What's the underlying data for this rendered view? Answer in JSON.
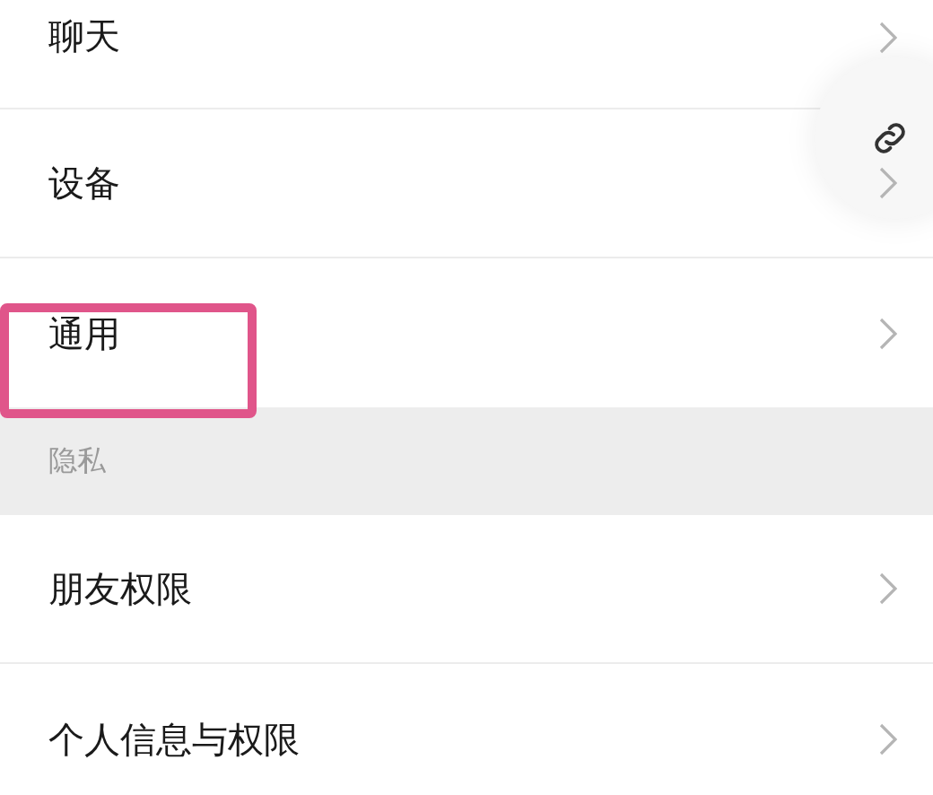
{
  "items": [
    {
      "kind": "row",
      "label": "聊天",
      "highlighted": false
    },
    {
      "kind": "row",
      "label": "设备",
      "highlighted": false
    },
    {
      "kind": "row",
      "label": "通用",
      "highlighted": true
    },
    {
      "kind": "header",
      "label": "隐私"
    },
    {
      "kind": "row",
      "label": "朋友权限",
      "highlighted": false
    },
    {
      "kind": "row",
      "label": "个人信息与权限",
      "highlighted": false
    }
  ]
}
